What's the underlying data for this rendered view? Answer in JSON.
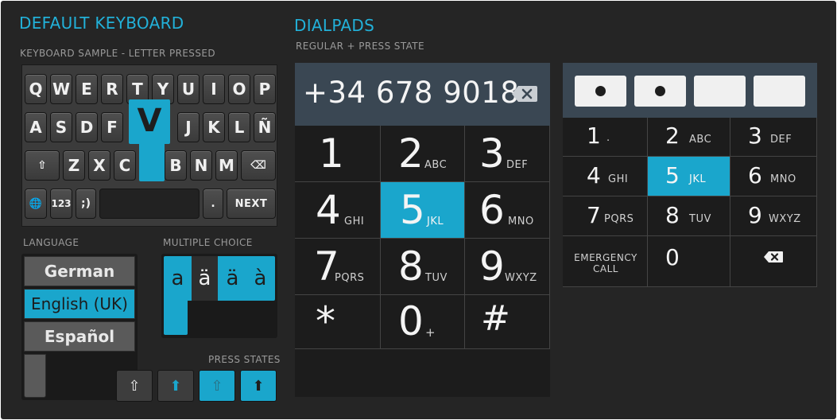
{
  "headings": {
    "default_keyboard": "DEFAULT KEYBOARD",
    "keyboard_sample": "KEYBOARD SAMPLE - LETTER PRESSED",
    "dialpads": "DIALPADS",
    "regular_press": "REGULAR + PRESS STATE",
    "language": "LANGUAGE",
    "multiple_choice": "MULTIPLE  CHOICE",
    "press_states": "PRESS STATES"
  },
  "keyboard": {
    "row1": [
      "Q",
      "W",
      "E",
      "R",
      "T",
      "Y",
      "U",
      "I",
      "O",
      "P"
    ],
    "row2": [
      "A",
      "S",
      "D",
      "F",
      "J",
      "K",
      "L",
      "Ñ"
    ],
    "row3": [
      "Z",
      "X",
      "C",
      "B",
      "N",
      "M"
    ],
    "pressed_letter": "V",
    "mode_key": "123",
    "smiley_key": ";)",
    "dot_key": ".",
    "next_key": "NEXT",
    "shift_icon": "⇧",
    "backspace_icon": "⌫",
    "globe_icon": "🌐"
  },
  "language": {
    "items": [
      "German",
      "English (UK)",
      "Español"
    ],
    "selected": "English (UK)"
  },
  "multiple_choice": {
    "chars": [
      "a",
      "ä",
      "ä",
      "à"
    ]
  },
  "press_states": {
    "icons": [
      "⇧",
      "⬆",
      "⇧",
      "⬆"
    ]
  },
  "dialpad1": {
    "display": "+34 678 9018",
    "keys": [
      {
        "d": "1",
        "l": ""
      },
      {
        "d": "2",
        "l": "ABC"
      },
      {
        "d": "3",
        "l": "DEF"
      },
      {
        "d": "4",
        "l": "GHI"
      },
      {
        "d": "5",
        "l": "JKL"
      },
      {
        "d": "6",
        "l": "MNO"
      },
      {
        "d": "7",
        "l": "PQRS"
      },
      {
        "d": "8",
        "l": "TUV"
      },
      {
        "d": "9",
        "l": "WXYZ"
      },
      {
        "d": "*",
        "l": ""
      },
      {
        "d": "0",
        "l": "+"
      },
      {
        "d": "#",
        "l": ""
      }
    ],
    "selected": "5"
  },
  "dialpad2": {
    "pin_filled": [
      true,
      true,
      false,
      false
    ],
    "keys": [
      {
        "d": "1",
        "l": "."
      },
      {
        "d": "2",
        "l": "ABC"
      },
      {
        "d": "3",
        "l": "DEF"
      },
      {
        "d": "4",
        "l": "GHI"
      },
      {
        "d": "5",
        "l": "JKL"
      },
      {
        "d": "6",
        "l": "MNO"
      },
      {
        "d": "7",
        "l": "PQRS"
      },
      {
        "d": "8",
        "l": "TUV"
      },
      {
        "d": "9",
        "l": "WXYZ"
      }
    ],
    "emergency": "EMERGENCY CALL",
    "zero": "0",
    "selected": "5"
  },
  "colors": {
    "accent": "#1aa6cc",
    "heading": "#22b1d9",
    "background": "#252525",
    "display": "#3a4753"
  }
}
